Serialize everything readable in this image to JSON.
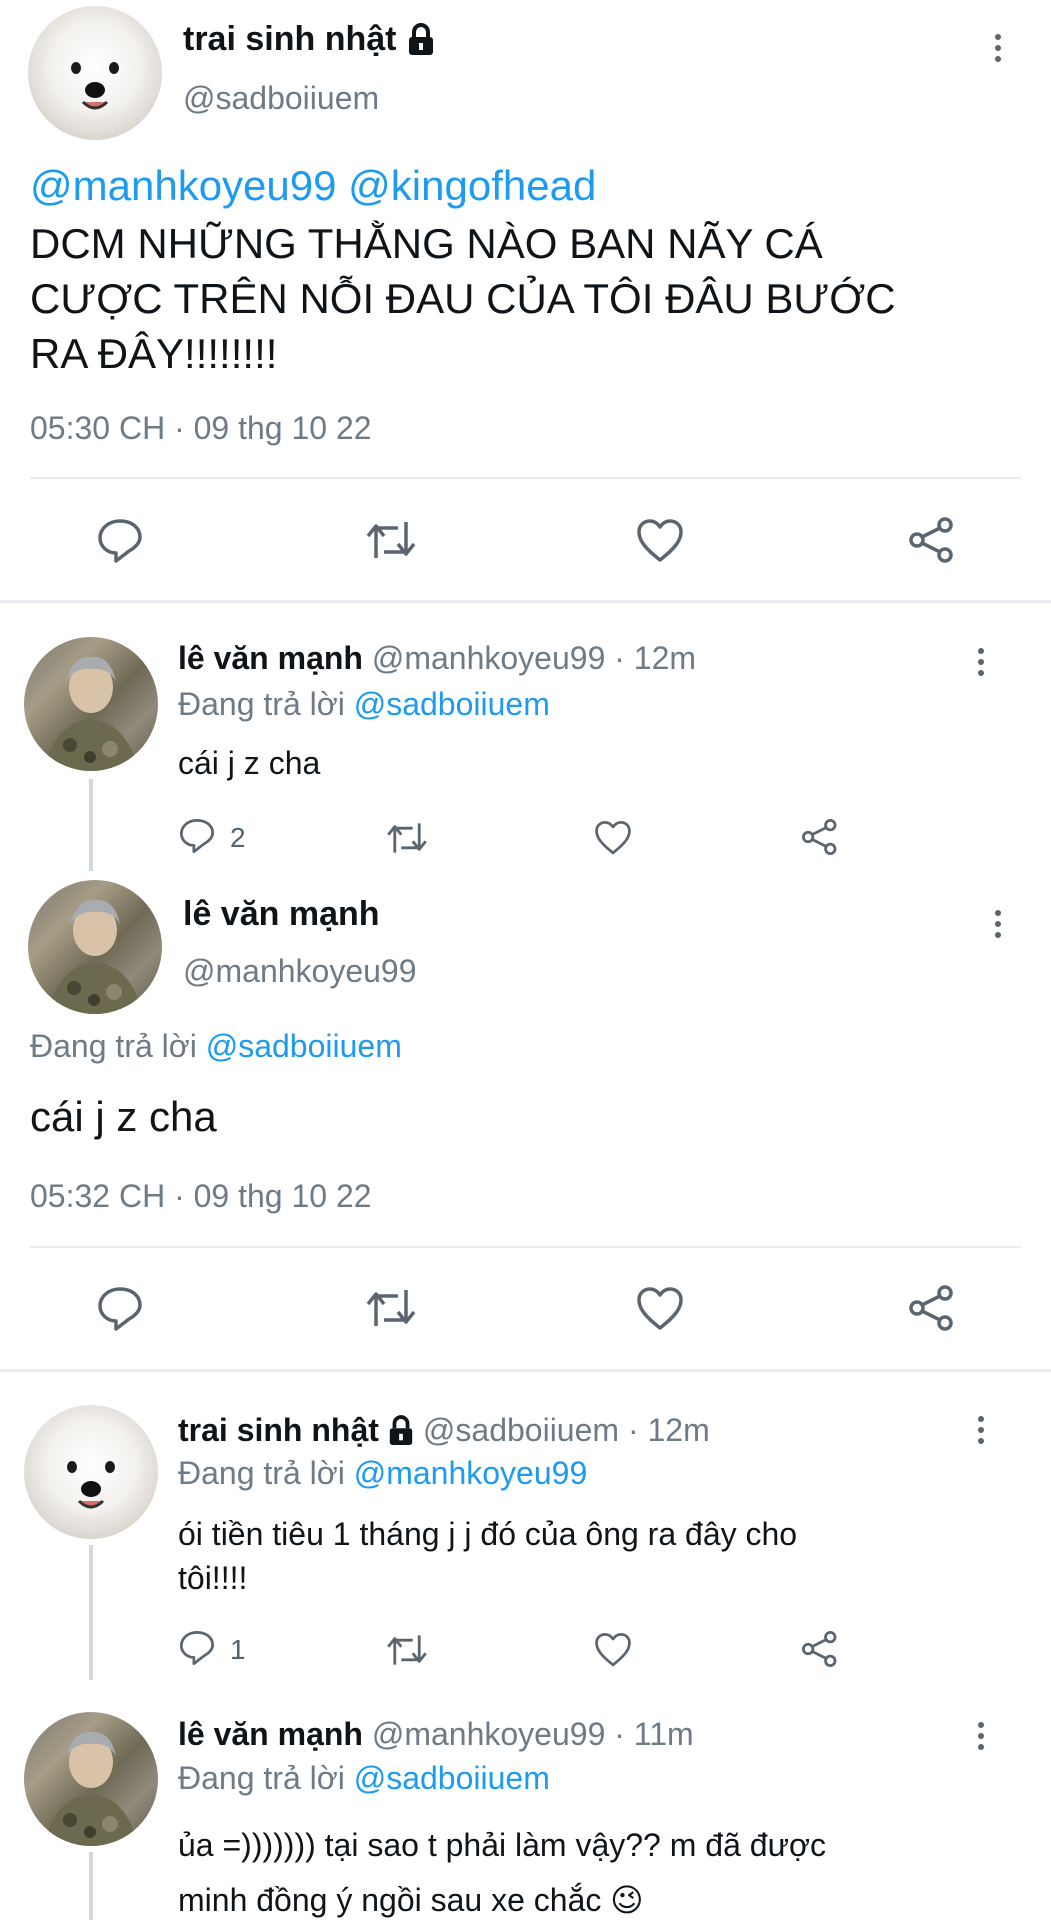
{
  "main_tweet": {
    "name": "trai sinh nhật",
    "handle": "@sadboiiuem",
    "mentions": "@manhkoyeu99 @kingofhead",
    "text_line1": "DCM NHỮNG THẰNG NÀO BAN NÃY CÁ",
    "text_line2": "CƯỢC TRÊN NỖI ĐAU CỦA TÔI ĐÂU BƯỚC",
    "text_line3": "RA ĐÂY!!!!!!!!",
    "timestamp": "05:30 CH · 09 thg 10 22"
  },
  "reply1": {
    "name": "lê văn mạnh",
    "meta": "@manhkoyeu99 · 12m",
    "replying_prefix": "Đang trả lời",
    "replying_to": "@sadboiiuem",
    "text": "cái j z cha",
    "reply_count": "2"
  },
  "focus_tweet": {
    "name": "lê văn mạnh",
    "handle": "@manhkoyeu99",
    "replying_prefix": "Đang trả lời",
    "replying_to": "@sadboiiuem",
    "text": "cái j z cha",
    "timestamp": "05:32 CH · 09 thg 10 22"
  },
  "reply2": {
    "name": "trai sinh nhật",
    "meta": "@sadboiiuem · 12m",
    "replying_prefix": "Đang trả lời",
    "replying_to": "@manhkoyeu99",
    "text_line1": "ói tiền tiêu 1 tháng j j đó của ông ra đây cho",
    "text_line2": "tôi!!!!",
    "reply_count": "1"
  },
  "reply3": {
    "name": "lê văn mạnh",
    "meta": "@manhkoyeu99 · 11m",
    "replying_prefix": "Đang trả lời",
    "replying_to": "@sadboiiuem",
    "text_line1": "ủa =))))))) tại sao t phải làm vậy?? m đã được",
    "text_line2": "minh đồng ý ngồi sau xe chắc 😉"
  },
  "icons": {
    "reply": "reply-icon",
    "retweet": "retweet-icon",
    "like": "like-icon",
    "share": "share-icon",
    "more": "more-icon",
    "lock": "lock-icon"
  },
  "colors": {
    "link": "#1d9bf0",
    "secondary": "#6e7a85",
    "divider": "#e6ecf0"
  }
}
